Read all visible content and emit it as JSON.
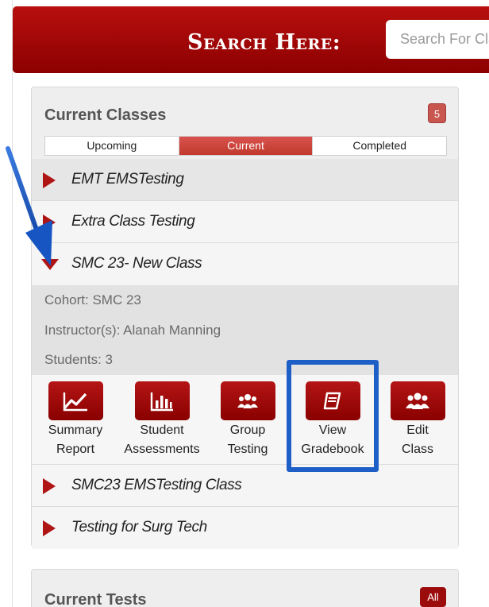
{
  "header": {
    "title": "Search Here:",
    "search_placeholder": "Search For Classes"
  },
  "current_classes": {
    "title": "Current Classes",
    "count": "5",
    "tabs": [
      {
        "label": "Upcoming",
        "active": false
      },
      {
        "label": "Current",
        "active": true
      },
      {
        "label": "Completed",
        "active": false
      }
    ],
    "classes": [
      {
        "name": "EMT EMSTesting",
        "expanded": false
      },
      {
        "name": "Extra Class Testing",
        "expanded": false
      },
      {
        "name": "SMC 23- New Class",
        "expanded": true
      },
      {
        "name": "SMC23 EMSTesting Class",
        "expanded": false
      },
      {
        "name": "Testing for Surg Tech",
        "expanded": false
      }
    ],
    "expanded_details": {
      "cohort": "Cohort: SMC 23",
      "instructors": "Instructor(s): Alanah Manning",
      "students": "Students: 3"
    },
    "actions": [
      {
        "label": "Summary\nReport",
        "icon": "line-chart-icon"
      },
      {
        "label": "Student\nAssessments",
        "icon": "bar-chart-icon"
      },
      {
        "label": "Group\nTesting",
        "icon": "group-icon"
      },
      {
        "label": "View\nGradebook",
        "icon": "book-icon"
      },
      {
        "label": "Edit\nClass",
        "icon": "users-icon"
      }
    ]
  },
  "current_tests": {
    "title": "Current Tests",
    "badge": "All"
  },
  "colors": {
    "brand_red": "#a50000",
    "annotation_blue": "#1e5ec7"
  }
}
